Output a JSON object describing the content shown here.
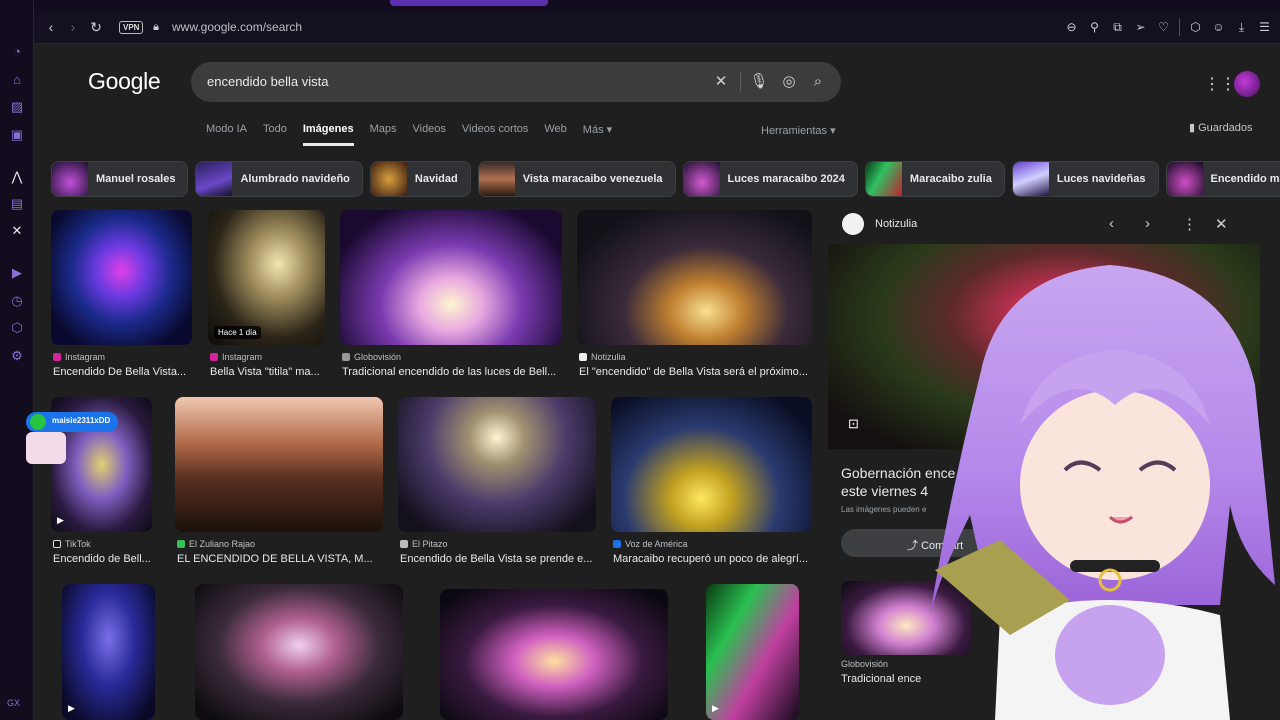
{
  "browser": {
    "url": "www.google.com/search",
    "vpn_label": "VPN"
  },
  "google": {
    "logo": "Google",
    "query": "encendido bella vista",
    "tabs": [
      "Modo IA",
      "Todo",
      "Imágenes",
      "Maps",
      "Videos",
      "Videos cortos",
      "Web",
      "Más ▾"
    ],
    "active_tab": "Imágenes",
    "tools": "Herramientas ▾",
    "saved": "Guardados"
  },
  "chips": [
    {
      "label": "Manuel rosales"
    },
    {
      "label": "Alumbrado navideño"
    },
    {
      "label": "Navidad"
    },
    {
      "label": "Vista maracaibo venezuela"
    },
    {
      "label": "Luces maracaibo 2024"
    },
    {
      "label": "Maracaibo zulia"
    },
    {
      "label": "Luces navideñas"
    },
    {
      "label": "Encendido maracaib"
    }
  ],
  "results": [
    {
      "source": "Instagram",
      "caption": "Encendido De Bella Vista...",
      "badge": ""
    },
    {
      "source": "Instagram",
      "caption": "Bella Vista \"titila\" ma...",
      "badge": "Hace 1 día"
    },
    {
      "source": "Globovisión",
      "caption": "Tradicional encendido de las luces de Bell...",
      "badge": ""
    },
    {
      "source": "Notizulia",
      "caption": "El \"encendido\" de Bella Vista será el próximo...",
      "badge": ""
    },
    {
      "source": "TikTok",
      "caption": "Encendido de Bell...",
      "badge": ""
    },
    {
      "source": "El Zuliano Rajao",
      "caption": "EL ENCENDIDO DE BELLA VISTA, M...",
      "badge": ""
    },
    {
      "source": "El Pitazo",
      "caption": "Encendido de Bella Vista se prende e...",
      "badge": ""
    },
    {
      "source": "Voz de América",
      "caption": "Maracaibo recuperó un poco de alegrí...",
      "badge": ""
    }
  ],
  "panel": {
    "source": "Notizulia",
    "title_line1": "Gobernación ence",
    "title_line2": "este viernes 4",
    "note": "Las imágenes pueden e",
    "share": "Compart",
    "related_source": "Globovisión",
    "related_caption": "Tradicional ence"
  },
  "chat": {
    "user": "maisie2311xDD"
  },
  "colors": {
    "accent": "#8b6fd6",
    "page_bg": "#1f1f1f",
    "chip_bg": "#303134"
  }
}
